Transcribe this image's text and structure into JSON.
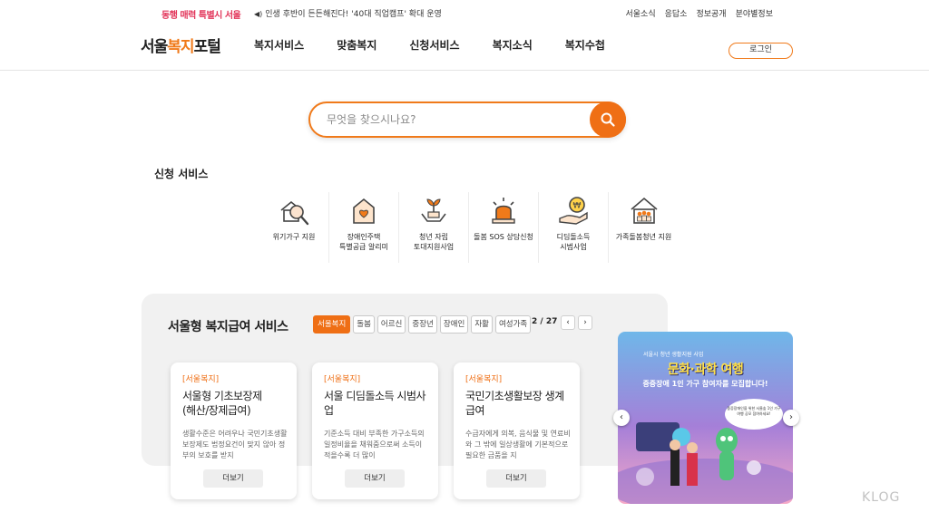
{
  "topbar": {
    "logo_text": "동행 매력 특별시 서울",
    "notice": "인생 후반이 든든해진다! '40대 직업캠프' 확대 운영",
    "links": [
      "서울소식",
      "응답소",
      "정보공개",
      "분야별정보"
    ]
  },
  "header": {
    "brand_prefix": "서울",
    "brand_accent": "복지",
    "brand_suffix": "포털",
    "nav": [
      "복지서비스",
      "맞춤복지",
      "신청서비스",
      "복지소식",
      "복지수첩"
    ],
    "login": "로그인"
  },
  "search": {
    "placeholder": "무엇을 찾으시나요?"
  },
  "services": {
    "title": "신청 서비스",
    "items": [
      {
        "label": "위기가구 지원",
        "icon": "house-magnifier-icon"
      },
      {
        "label": "장애인주택\n특별공급 알리미",
        "icon": "house-heart-icon"
      },
      {
        "label": "청년 자립\n토대지원사업",
        "icon": "sprout-hands-icon"
      },
      {
        "label": "돌봄 SOS 상담신청",
        "icon": "siren-icon"
      },
      {
        "label": "디딤돌소득\n시범사업",
        "icon": "coin-hand-icon"
      },
      {
        "label": "가족돌봄청년 지원",
        "icon": "family-house-icon"
      }
    ]
  },
  "benefits": {
    "title": "서울형 복지급여 서비스",
    "tabs": [
      "서울복지",
      "돌봄",
      "어르신",
      "중장년",
      "장애인",
      "자활",
      "여성가족"
    ],
    "active_tab": "서울복지",
    "pager": "2 / 27",
    "prev": "‹",
    "next": "›",
    "cards": [
      {
        "tag": "[서울복지]",
        "title": "서울형 기초보장제\n(해산/장제급여)",
        "desc": "생활수준은 어려우나 국민기초생활보장제도 법정요건이 맞지 않아 정부의 보호를 받지",
        "more": "더보기"
      },
      {
        "tag": "[서울복지]",
        "title": "서울 디딤돌소득 시범사업",
        "desc": "기준소득 대비 부족한 가구소득의 일정비율을 채워줌으로써 소득이 적을수록 더 많이",
        "more": "더보기"
      },
      {
        "tag": "[서울복지]",
        "title": "국민기초생활보장 생계급여",
        "desc": "수급자에게 의복, 음식물 및 연료비와 그 밖에 일상생활에 기본적으로 필요한 금품을 지",
        "more": "더보기"
      }
    ]
  },
  "banner": {
    "line1": "서울시 청년 생활지원 사업",
    "headline": "문화·과학 여행",
    "sub": "중증장애 1인 가구 참여자를 모집합니다!",
    "bubble": "중증장애인을 위한 서울숲 1인 가구 여행 공모 참여하세요!",
    "prev": "‹",
    "next": "›"
  },
  "watermark": "KLOG",
  "colors": {
    "accent": "#ef6f15",
    "panel_bg": "#f1f1f1"
  }
}
